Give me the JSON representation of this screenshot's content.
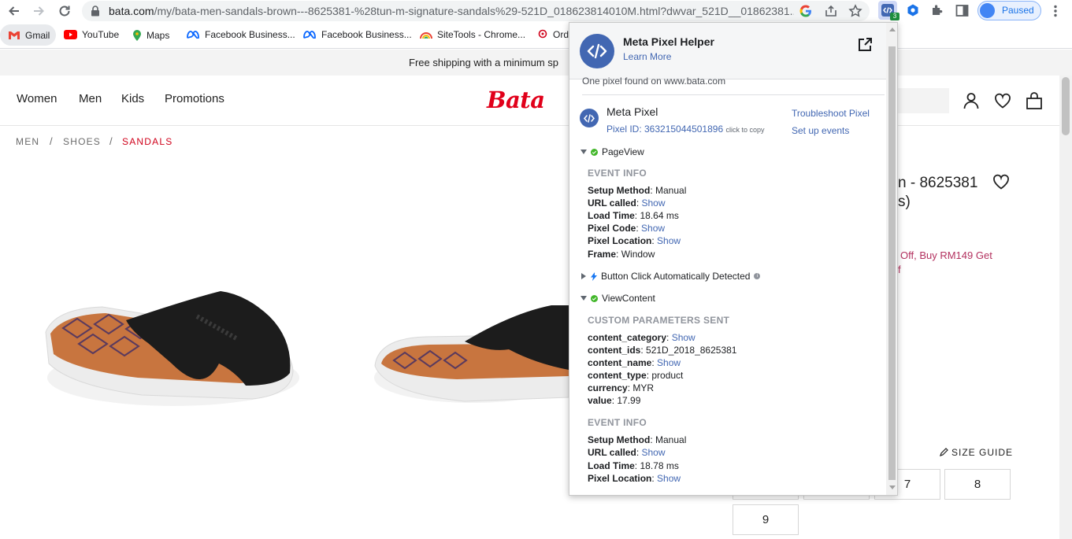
{
  "browser": {
    "url_host": "bata.com",
    "url_path": "/my/bata-men-sandals-brown---8625381-%28tun-m-signature-sandals%29-521D_018623814010M.html?dwvar_521D__01862381...",
    "ext_badge": "3",
    "profile_label": "Paused"
  },
  "bookmarks": [
    {
      "label": "Gmail"
    },
    {
      "label": "YouTube"
    },
    {
      "label": "Maps"
    },
    {
      "label": "Facebook Business..."
    },
    {
      "label": "Facebook Business..."
    },
    {
      "label": "SiteTools - Chrome..."
    },
    {
      "label": "Ord"
    }
  ],
  "site": {
    "banner": "Free shipping with a minimum sp",
    "nav": [
      "Women",
      "Men",
      "Kids",
      "Promotions"
    ],
    "logo": "Bata",
    "breadcrumb": [
      "MEN",
      "SHOES",
      "SANDALS"
    ],
    "breadcrumb_sep": "/",
    "title_line1": "n - 8625381",
    "title_line2": "s)",
    "promo_line1": "Off, Buy RM149 Get",
    "promo_line2": "f",
    "size_guide": "SIZE GUIDE",
    "sizes": [
      "7",
      "8",
      "9"
    ]
  },
  "popup": {
    "title": "Meta Pixel Helper",
    "learn_more": "Learn More",
    "found": "One pixel found on www.bata.com",
    "pixel_name": "Meta Pixel",
    "pixel_id": "Pixel ID: 363215044501896",
    "click_to_copy": "click to copy",
    "troubleshoot": "Troubleshoot Pixel",
    "setup_events": "Set up events",
    "event_pageview": "PageView",
    "event_button_click": "Button Click Automatically Detected",
    "event_viewcontent": "ViewContent",
    "event_info_heading": "EVENT INFO",
    "custom_params_heading": "CUSTOM PARAMETERS SENT",
    "show": "Show",
    "pageview_info": [
      {
        "key": "Setup Method",
        "sep": ": ",
        "value": "Manual",
        "link": false
      },
      {
        "key": "URL called",
        "sep": ":  ",
        "value": "Show",
        "link": true
      },
      {
        "key": "Load Time",
        "sep": ": ",
        "value": "18.64 ms",
        "link": false
      },
      {
        "key": "Pixel Code",
        "sep": ":  ",
        "value": "Show",
        "link": true
      },
      {
        "key": "Pixel Location",
        "sep": ":  ",
        "value": "Show",
        "link": true
      },
      {
        "key": "Frame",
        "sep": ": ",
        "value": "Window",
        "link": false
      }
    ],
    "custom_params": [
      {
        "key": "content_category",
        "sep": ":  ",
        "value": "Show",
        "link": true
      },
      {
        "key": "content_ids",
        "sep": ": ",
        "value": "521D_2018_8625381",
        "link": false
      },
      {
        "key": "content_name",
        "sep": ":  ",
        "value": "Show",
        "link": true
      },
      {
        "key": "content_type",
        "sep": ": ",
        "value": "product",
        "link": false
      },
      {
        "key": "currency",
        "sep": ": ",
        "value": "MYR",
        "link": false
      },
      {
        "key": "value",
        "sep": ": ",
        "value": "17.99",
        "link": false
      }
    ],
    "viewcontent_info": [
      {
        "key": "Setup Method",
        "sep": ": ",
        "value": "Manual",
        "link": false
      },
      {
        "key": "URL called",
        "sep": ":  ",
        "value": "Show",
        "link": true
      },
      {
        "key": "Load Time",
        "sep": ": ",
        "value": "18.78 ms",
        "link": false
      },
      {
        "key": "Pixel Location",
        "sep": ":  ",
        "value": "Show",
        "link": true
      }
    ]
  }
}
